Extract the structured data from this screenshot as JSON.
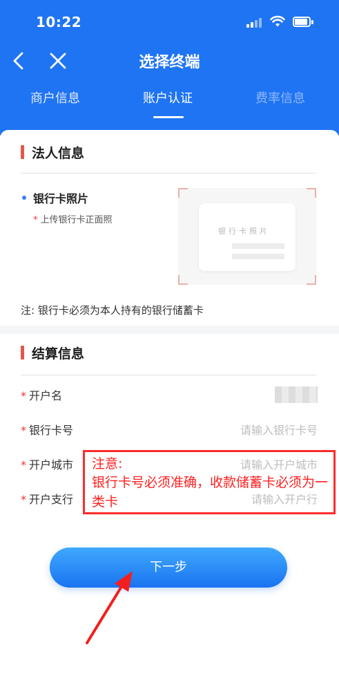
{
  "status_bar": {
    "time": "10:22"
  },
  "nav": {
    "title": "选择终端"
  },
  "tabs": [
    {
      "label": "商户信息"
    },
    {
      "label": "账户认证"
    },
    {
      "label": "费率信息"
    }
  ],
  "legal_section": {
    "title": "法人信息",
    "bank_card_photo": {
      "label": "银行卡照片",
      "required_mark": "*",
      "hint": "上传银行卡正面照",
      "illustration_text": "银行卡照片"
    },
    "note": "注: 银行卡必须为本人持有的银行储蓄卡"
  },
  "settlement_section": {
    "title": "结算信息",
    "fields": [
      {
        "required_mark": "*",
        "label": "开户名",
        "value": ""
      },
      {
        "required_mark": "*",
        "label": "银行卡号",
        "placeholder": "请输入银行卡号"
      },
      {
        "required_mark": "*",
        "label": "开户城市",
        "placeholder": "请输入开户城市"
      },
      {
        "required_mark": "*",
        "label": "开户支行",
        "placeholder": "请输入开户行"
      }
    ]
  },
  "annotation": {
    "title": "注意:",
    "text": "银行卡号必须准确，收款储蓄卡必须为一类卡"
  },
  "next_button": {
    "label": "下一步"
  },
  "colors": {
    "brand_blue": "#1f74f3",
    "section_accent": "#e0584c",
    "annotation_red": "#ff2a2a"
  }
}
